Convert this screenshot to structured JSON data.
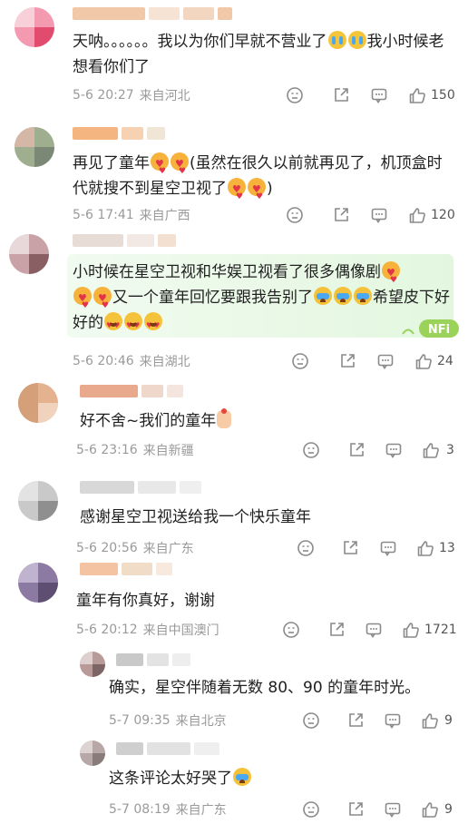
{
  "comments": [
    {
      "avatar_colors": [
        "#f39ab0",
        "#e14b6e",
        "#f8d0da"
      ],
      "name_colors": [
        "#f1c8a8",
        "#f7e3d4",
        "#f3d6c0"
      ],
      "text_parts": [
        "天呐。。。。。。我以为你们早就不营业了",
        "",
        "",
        "我小时候老想看你们了"
      ],
      "time": "5-6 20:27",
      "location": "来自河北",
      "likes": "150",
      "emojis": [
        "cry",
        "cry"
      ]
    },
    {
      "avatar_colors": [
        "#9fae8f",
        "#d4b7a7",
        "#7b8876"
      ],
      "name_colors": [
        "#f4b580",
        "#f6d2b3",
        "#f1e5d6"
      ],
      "text_parts": [
        "再见了童年",
        "",
        "",
        "(虽然在很久以前就再见了，机顶盒时代就搜不到星空卫视了",
        "",
        "",
        ")"
      ],
      "time": "5-6 17:41",
      "location": "来自广西",
      "likes": "120",
      "emojis": [
        "heart",
        "heart",
        "heart",
        "heart"
      ]
    },
    {
      "avatar_colors": [
        "#c8a2a6",
        "#8a5f64",
        "#e8d8da"
      ],
      "name_colors": [
        "#e7dcd6",
        "#f3e9e4",
        "#f4e0d0"
      ],
      "text_parts": [
        "小时候在星空卫视和华娱卫视看了很多偶像剧",
        "",
        "",
        "",
        "又一个童年回忆要跟我告别了",
        "",
        "",
        "",
        "希望皮下好好的",
        "",
        "",
        ""
      ],
      "time": "5-6 20:46",
      "location": "来自湖北",
      "likes": "24",
      "sticker_text": "NFi"
    },
    {
      "avatar_colors": [
        "#e4b28f",
        "#d59f7a",
        "#f1d3bd"
      ],
      "name_colors": [
        "#e9a98d",
        "#f0d7cc",
        "#f4e5de"
      ],
      "text_parts": [
        "好不舍~我们的童年",
        ""
      ],
      "time": "5-6 23:16",
      "location": "来自新疆",
      "likes": "3"
    },
    {
      "avatar_colors": [
        "#c9c9c9",
        "#8f8f8f",
        "#e3e3e3"
      ],
      "name_colors": [
        "#d8d8d8",
        "#e8e8e8",
        "#efefef"
      ],
      "text_parts": [
        "感谢星空卫视送给我一个快乐童年"
      ],
      "time": "5-6 20:56",
      "location": "来自广东",
      "likes": "13"
    },
    {
      "avatar_colors": [
        "#8c7aa2",
        "#5d4e72",
        "#bfb3cf"
      ],
      "name_colors": [
        "#f4c3a2",
        "#f1dcc8",
        "#f8e9de"
      ],
      "text_parts": [
        "童年有你真好，谢谢"
      ],
      "time": "5-6 20:12",
      "location": "来自中国澳门",
      "likes": "1721"
    }
  ],
  "replies": [
    {
      "avatar_colors": [
        "#b89a98",
        "#7d6565",
        "#ddd0cf"
      ],
      "name_colors": [
        "#c9c9c9",
        "#e3e3e3",
        "#eeeeee"
      ],
      "text_parts": [
        "确实，星空伴随着无数 80、90 的童年时光。"
      ],
      "time": "5-7 09:35",
      "location": "来自北京",
      "likes": "9"
    },
    {
      "avatar_colors": [
        "#b8a7a7",
        "#8a7b7b",
        "#ded3d3"
      ],
      "name_colors": [
        "#cfcfcf",
        "#e2e2e2",
        "#efefef"
      ],
      "text_parts": [
        "这条评论太好哭了",
        ""
      ],
      "time": "5-7 08:19",
      "location": "来自广东",
      "likes": "9"
    }
  ]
}
